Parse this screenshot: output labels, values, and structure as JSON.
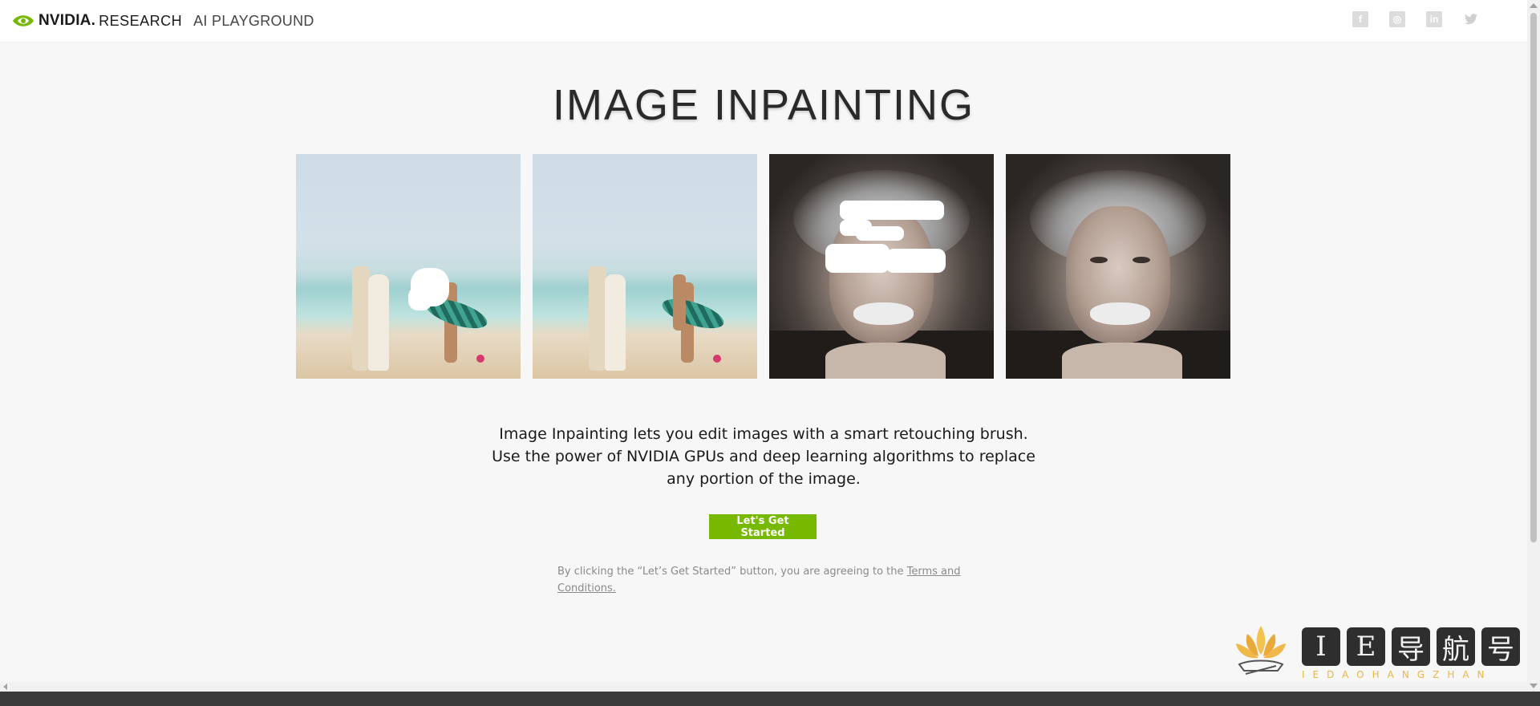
{
  "header": {
    "brand_nvidia": "NVIDIA.",
    "brand_research": "RESEARCH",
    "brand_playground": "AI PLAYGROUND",
    "social": [
      {
        "name": "facebook-icon",
        "glyph": "f"
      },
      {
        "name": "instagram-icon",
        "glyph": "◎"
      },
      {
        "name": "linkedin-icon",
        "glyph": "in"
      },
      {
        "name": "twitter-icon",
        "glyph": "🐦"
      }
    ]
  },
  "hero": {
    "title": "IMAGE INPAINTING"
  },
  "description": {
    "line1": "Image Inpainting lets you edit images with a smart retouching brush.",
    "line2": "Use the power of NVIDIA GPUs and deep learning algorithms to replace",
    "line3": "any portion of the image."
  },
  "cta": {
    "label": "Let's Get Started"
  },
  "terms": {
    "prefix": "By clicking the “Let’s Get Started” button, you are agreeing to the ",
    "link": "Terms and Conditions."
  },
  "watermark": {
    "chars": [
      "I",
      "E",
      "导",
      "航",
      "号"
    ],
    "sub": "IEDAOHANGZHAN"
  },
  "colors": {
    "accent": "#76b900",
    "background": "#f7f7f7",
    "header_bg": "#ffffff",
    "watermark_gold": "#e8b64a"
  }
}
